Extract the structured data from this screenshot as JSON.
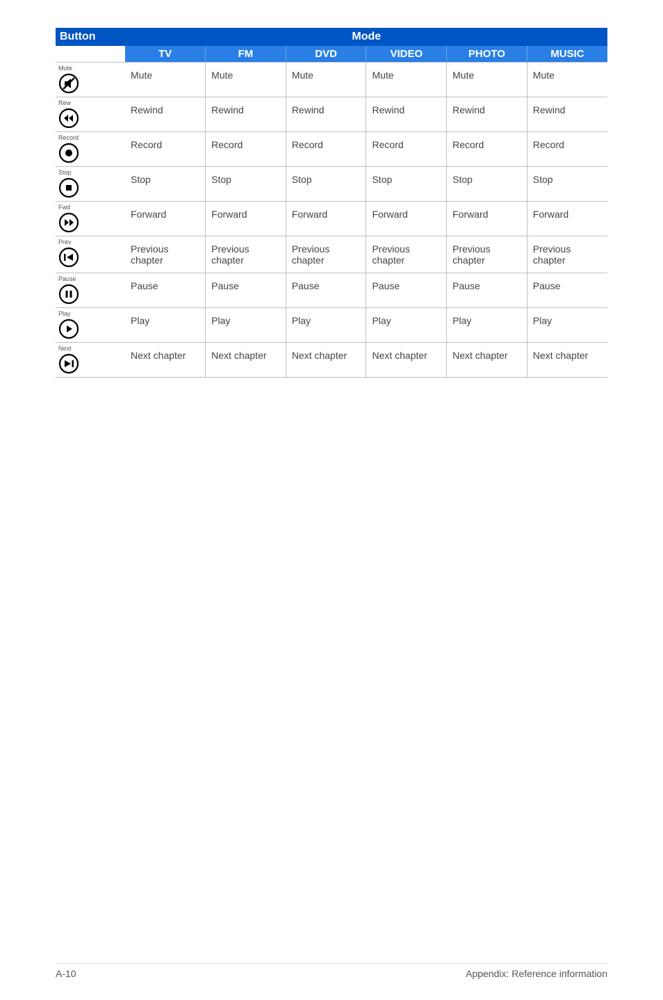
{
  "header": {
    "button_col": "Button",
    "mode_col": "Mode",
    "modes": [
      "TV",
      "FM",
      "DVD",
      "VIDEO",
      "PHOTO",
      "MUSIC"
    ]
  },
  "rows": [
    {
      "button_label": "Mute",
      "icon": "mute",
      "cells": [
        "Mute",
        "Mute",
        "Mute",
        "Mute",
        "Mute",
        "Mute"
      ]
    },
    {
      "button_label": "Rew",
      "icon": "rew",
      "cells": [
        "Rewind",
        "Rewind",
        "Rewind",
        "Rewind",
        "Rewind",
        "Rewind"
      ]
    },
    {
      "button_label": "Record",
      "icon": "record",
      "cells": [
        "Record",
        "Record",
        "Record",
        "Record",
        "Record",
        "Record"
      ]
    },
    {
      "button_label": "Stop",
      "icon": "stop",
      "cells": [
        "Stop",
        "Stop",
        "Stop",
        "Stop",
        "Stop",
        "Stop"
      ]
    },
    {
      "button_label": "Fwd",
      "icon": "fwd",
      "cells": [
        "Forward",
        "Forward",
        "Forward",
        "Forward",
        "Forward",
        "Forward"
      ]
    },
    {
      "button_label": "Prev",
      "icon": "prev",
      "cells": [
        "Previous chapter",
        "Previous chapter",
        "Previous chapter",
        "Previous chapter",
        "Previous chapter",
        "Previous chapter"
      ]
    },
    {
      "button_label": "Pause",
      "icon": "pause",
      "cells": [
        "Pause",
        "Pause",
        "Pause",
        "Pause",
        "Pause",
        "Pause"
      ]
    },
    {
      "button_label": "Play",
      "icon": "play",
      "cells": [
        "Play",
        "Play",
        "Play",
        "Play",
        "Play",
        "Play"
      ]
    },
    {
      "button_label": "Next",
      "icon": "next",
      "cells": [
        "Next chapter",
        "Next chapter",
        "Next chapter",
        "Next chapter",
        "Next chapter",
        "Next chapter"
      ]
    }
  ],
  "footer": {
    "page_number": "A-10",
    "section": "Appendix: Reference information"
  }
}
